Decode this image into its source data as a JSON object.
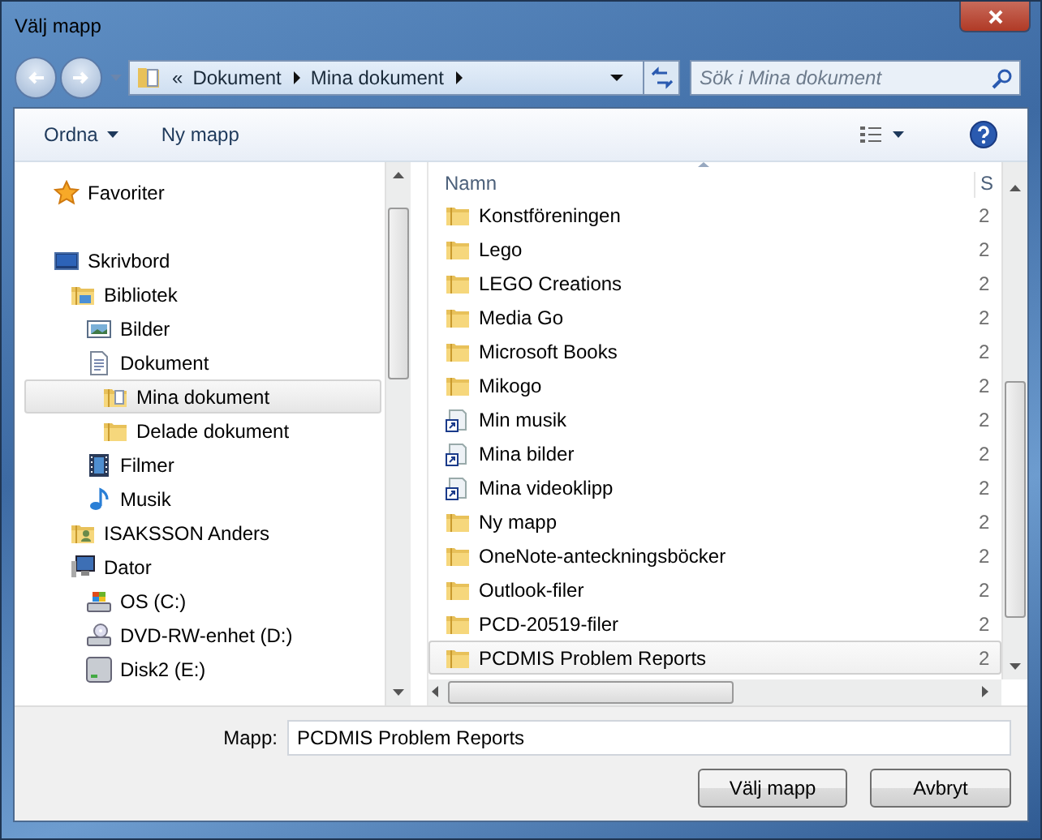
{
  "window": {
    "title": "Välj mapp"
  },
  "address_bar": {
    "overflow": "«",
    "crumbs": [
      "Dokument",
      "Mina dokument"
    ]
  },
  "search": {
    "placeholder": "Sök i Mina dokument"
  },
  "toolbar": {
    "organize": "Ordna",
    "new_folder": "Ny mapp"
  },
  "navigation_tree": [
    {
      "label": "Favoriter",
      "kind": "star",
      "selected": false
    },
    {
      "label": "Skrivbord",
      "kind": "desktop",
      "selected": false,
      "children": [
        {
          "label": "Bibliotek",
          "kind": "library",
          "selected": false,
          "children": [
            {
              "label": "Bilder",
              "kind": "pictures",
              "selected": false
            },
            {
              "label": "Dokument",
              "kind": "document",
              "selected": false,
              "children": [
                {
                  "label": "Mina dokument",
                  "kind": "docfolder",
                  "selected": true
                },
                {
                  "label": "Delade dokument",
                  "kind": "folder",
                  "selected": false
                }
              ]
            },
            {
              "label": "Filmer",
              "kind": "film",
              "selected": false
            },
            {
              "label": "Musik",
              "kind": "music",
              "selected": false
            }
          ]
        },
        {
          "label": "ISAKSSON Anders",
          "kind": "user",
          "selected": false
        },
        {
          "label": "Dator",
          "kind": "computer",
          "selected": false,
          "children": [
            {
              "label": "OS (C:)",
              "kind": "osdrive",
              "selected": false
            },
            {
              "label": "DVD-RW-enhet (D:)",
              "kind": "dvd",
              "selected": false
            },
            {
              "label": "Disk2 (E:)",
              "kind": "drive",
              "selected": false
            }
          ]
        }
      ]
    }
  ],
  "file_list": {
    "columns": [
      "Namn",
      "S"
    ],
    "rows": [
      {
        "name": "Konstföreningen",
        "column_2": "2",
        "kind": "folder",
        "selected": false
      },
      {
        "name": "Lego",
        "column_2": "2",
        "kind": "folder",
        "selected": false
      },
      {
        "name": "LEGO Creations",
        "column_2": "2",
        "kind": "folder",
        "selected": false
      },
      {
        "name": "Media Go",
        "column_2": "2",
        "kind": "folder",
        "selected": false
      },
      {
        "name": "Microsoft Books",
        "column_2": "2",
        "kind": "folder",
        "selected": false
      },
      {
        "name": "Mikogo",
        "column_2": "2",
        "kind": "folder",
        "selected": false
      },
      {
        "name": "Min musik",
        "column_2": "2",
        "kind": "shortcut",
        "selected": false
      },
      {
        "name": "Mina bilder",
        "column_2": "2",
        "kind": "shortcut",
        "selected": false
      },
      {
        "name": "Mina videoklipp",
        "column_2": "2",
        "kind": "shortcut",
        "selected": false
      },
      {
        "name": "Ny mapp",
        "column_2": "2",
        "kind": "folder",
        "selected": false
      },
      {
        "name": "OneNote-anteckningsböcker",
        "column_2": "2",
        "kind": "folder",
        "selected": false
      },
      {
        "name": "Outlook-filer",
        "column_2": "2",
        "kind": "folder",
        "selected": false
      },
      {
        "name": "PCD-20519-filer",
        "column_2": "2",
        "kind": "folder",
        "selected": false
      },
      {
        "name": "PCDMIS Problem Reports",
        "column_2": "2",
        "kind": "folder",
        "selected": true
      }
    ]
  },
  "footer": {
    "label": "Mapp:",
    "value": "PCDMIS Problem Reports",
    "buttons": [
      "Välj mapp",
      "Avbryt"
    ]
  }
}
